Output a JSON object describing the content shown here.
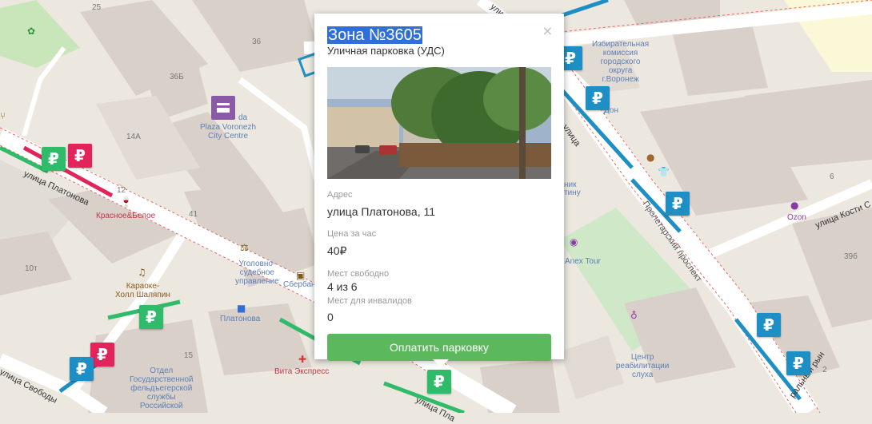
{
  "popup": {
    "title": "Зона №3605",
    "subtitle": "Уличная парковка (УДС)",
    "close_label": "×",
    "fields": [
      {
        "label": "Адрес",
        "value": "улица Платонова, 11"
      },
      {
        "label": "Цена за час",
        "value": "40₽"
      },
      {
        "label": "Мест свободно",
        "value": "4 из 6"
      },
      {
        "label": "Мест для инвалидов",
        "value": "0"
      }
    ],
    "pay_button": "Оплатить парковку"
  },
  "map": {
    "marker_symbol": "₽",
    "colors": {
      "free": "#2fbb6a",
      "paid": "#1d8fc4",
      "disabled": "#e3245a",
      "button": "#5cb85c"
    },
    "labels": {
      "n25": "25",
      "n36": "36",
      "n36b": "36Б",
      "n14a": "14А",
      "n12": "12",
      "n41": "41",
      "n10t": "10т",
      "n15": "15",
      "n39b": "39б",
      "n6": "6",
      "n2": "2",
      "plaza": "Plaza Voronezh\nCity Centre",
      "plaza_prefix": "da",
      "izbirkom": "Избирательная\nкомиссия\nгородского\nокруга\nг.Воронеж",
      "don": "Дон",
      "krasnoe": "Красное&Белое",
      "karaoke": "Караоке-\nХолл Шаляпин",
      "ugolovno": "Уголовно-\nсудебное\nуправление",
      "sberbank": "Сбербан",
      "platonova_stop": "Платонова",
      "otdel": "Отдел\nГосударственной\nфельдъегерской\nслужбы\nРоссийской",
      "vita": "Вита Экспресс",
      "ozon": "Ozon",
      "anex": "Anex Tour",
      "tintin": "тину",
      "nik": "ник",
      "center": "Центр\nреабилитации\nслуха",
      "st_platonova": "улица Платонова",
      "st_platonova2": "улица Пла",
      "st_svobody": "улица Свободы",
      "st_kosti": "улица Кости С",
      "st_ulitsa": "улица",
      "st_vertical": "Пролетарский проспект",
      "st_top": "улица",
      "st_bottom_right": "ральный рын"
    }
  }
}
